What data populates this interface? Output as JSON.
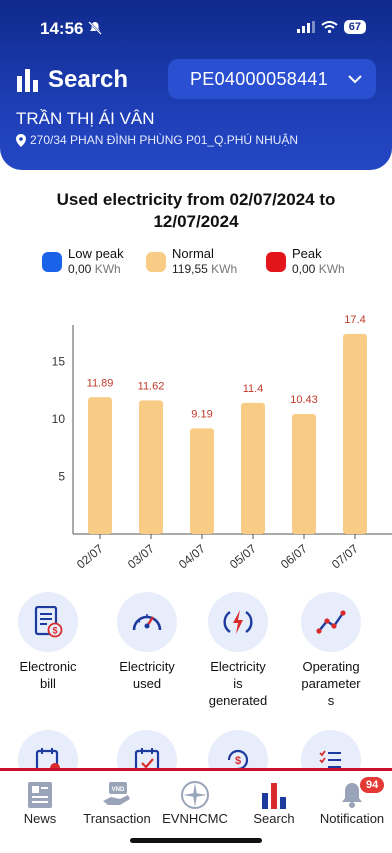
{
  "status_bar": {
    "time": "14:56",
    "battery": "67"
  },
  "header": {
    "title": "Search",
    "account_id": "PE04000058441",
    "customer_name": "TRẦN THỊ ÁI VÂN",
    "address": "270/34 PHAN ĐÌNH PHÙNG P01_Q.PHÚ NHUẬN"
  },
  "chart_title_line1": "Used electricity from 02/07/2024 to",
  "chart_title_line2": "12/07/2024",
  "legend": [
    {
      "label": "Low peak",
      "value": "0,00",
      "unit": "KWh",
      "color": "#1a63e8"
    },
    {
      "label": "Normal",
      "value": "119,55",
      "unit": "KWh",
      "color": "#f9cc85"
    },
    {
      "label": "Peak",
      "value": "0,00",
      "unit": "KWh",
      "color": "#e3151b"
    }
  ],
  "chart_data": {
    "type": "bar",
    "categories": [
      "02/07",
      "03/07",
      "04/07",
      "05/07",
      "06/07",
      "07/07"
    ],
    "series": [
      {
        "name": "Normal",
        "values": [
          11.89,
          11.62,
          9.19,
          11.4,
          10.43,
          17.4
        ]
      }
    ],
    "value_labels": [
      "11.89",
      "11.62",
      "9.19",
      "11.4",
      "10.43",
      "17.4"
    ],
    "yticks": [
      5,
      10,
      15
    ],
    "ylim": [
      0,
      18
    ],
    "grid": false,
    "bar_color": "#f9cc85",
    "label_color": "#c0392b"
  },
  "menu": [
    {
      "label_lines": [
        "Electronic",
        "bill"
      ],
      "icon": "bill-icon"
    },
    {
      "label_lines": [
        "Electricity",
        "used"
      ],
      "icon": "gauge-icon"
    },
    {
      "label_lines": [
        "Electricity",
        "is",
        "generated"
      ],
      "icon": "power-icon"
    },
    {
      "label_lines": [
        "Operating",
        "parameter",
        "s"
      ],
      "icon": "line-chart-icon"
    }
  ],
  "tabs": [
    {
      "label": "News",
      "icon": "news-icon"
    },
    {
      "label": "Transaction",
      "icon": "transaction-icon"
    },
    {
      "label": "EVNHCMC",
      "icon": "evn-logo-icon"
    },
    {
      "label": "Search",
      "icon": "bar-chart-icon"
    },
    {
      "label": "Notification",
      "icon": "bell-icon",
      "badge": "94"
    }
  ]
}
